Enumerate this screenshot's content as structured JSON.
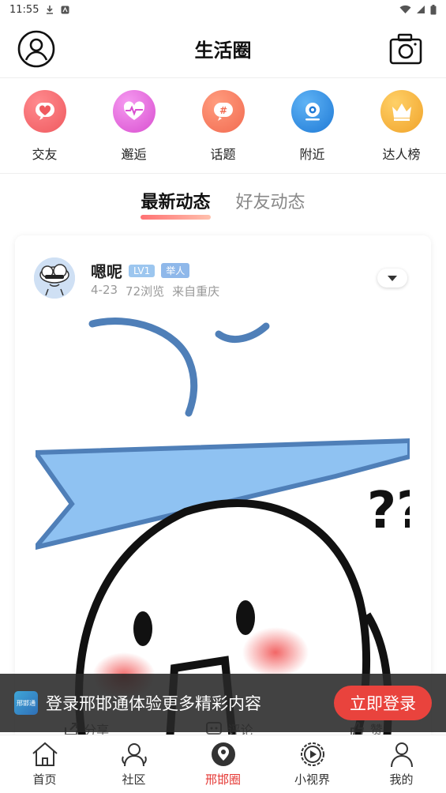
{
  "status_bar": {
    "time": "11:55"
  },
  "header": {
    "title": "生活圈"
  },
  "quick_links": [
    {
      "label": "交友",
      "icon": "heart-icon",
      "color": "#ef5a5f"
    },
    {
      "label": "邂逅",
      "icon": "heartbeat-icon",
      "color": "#e25bd6"
    },
    {
      "label": "话题",
      "icon": "hashtag-icon",
      "color": "#f5745c"
    },
    {
      "label": "附近",
      "icon": "location-icon",
      "color": "#2f8de4"
    },
    {
      "label": "达人榜",
      "icon": "crown-icon",
      "color": "#f2b33a"
    }
  ],
  "tabs": [
    {
      "label": "最新动态",
      "active": true
    },
    {
      "label": "好友动态",
      "active": false
    }
  ],
  "post": {
    "author": "嗯呢",
    "level": "LV1",
    "role": "举人",
    "date": "4-23",
    "views": "72浏览",
    "location": "来自重庆",
    "actions": {
      "share": "分享",
      "comment": "评论",
      "like": "赞"
    }
  },
  "login_banner": {
    "logo_text": "邢邯通",
    "text": "登录邢邯通体验更多精彩内容",
    "button": "立即登录"
  },
  "bottom_nav": [
    {
      "label": "首页",
      "icon": "home-icon",
      "active": false
    },
    {
      "label": "社区",
      "icon": "community-icon",
      "active": false
    },
    {
      "label": "邢邯圈",
      "icon": "circle-location-icon",
      "active": true
    },
    {
      "label": "小视界",
      "icon": "play-icon",
      "active": false
    },
    {
      "label": "我的",
      "icon": "person-icon",
      "active": false
    }
  ],
  "colors": {
    "accent": "#e53935",
    "badge": "#9cc6ef"
  }
}
